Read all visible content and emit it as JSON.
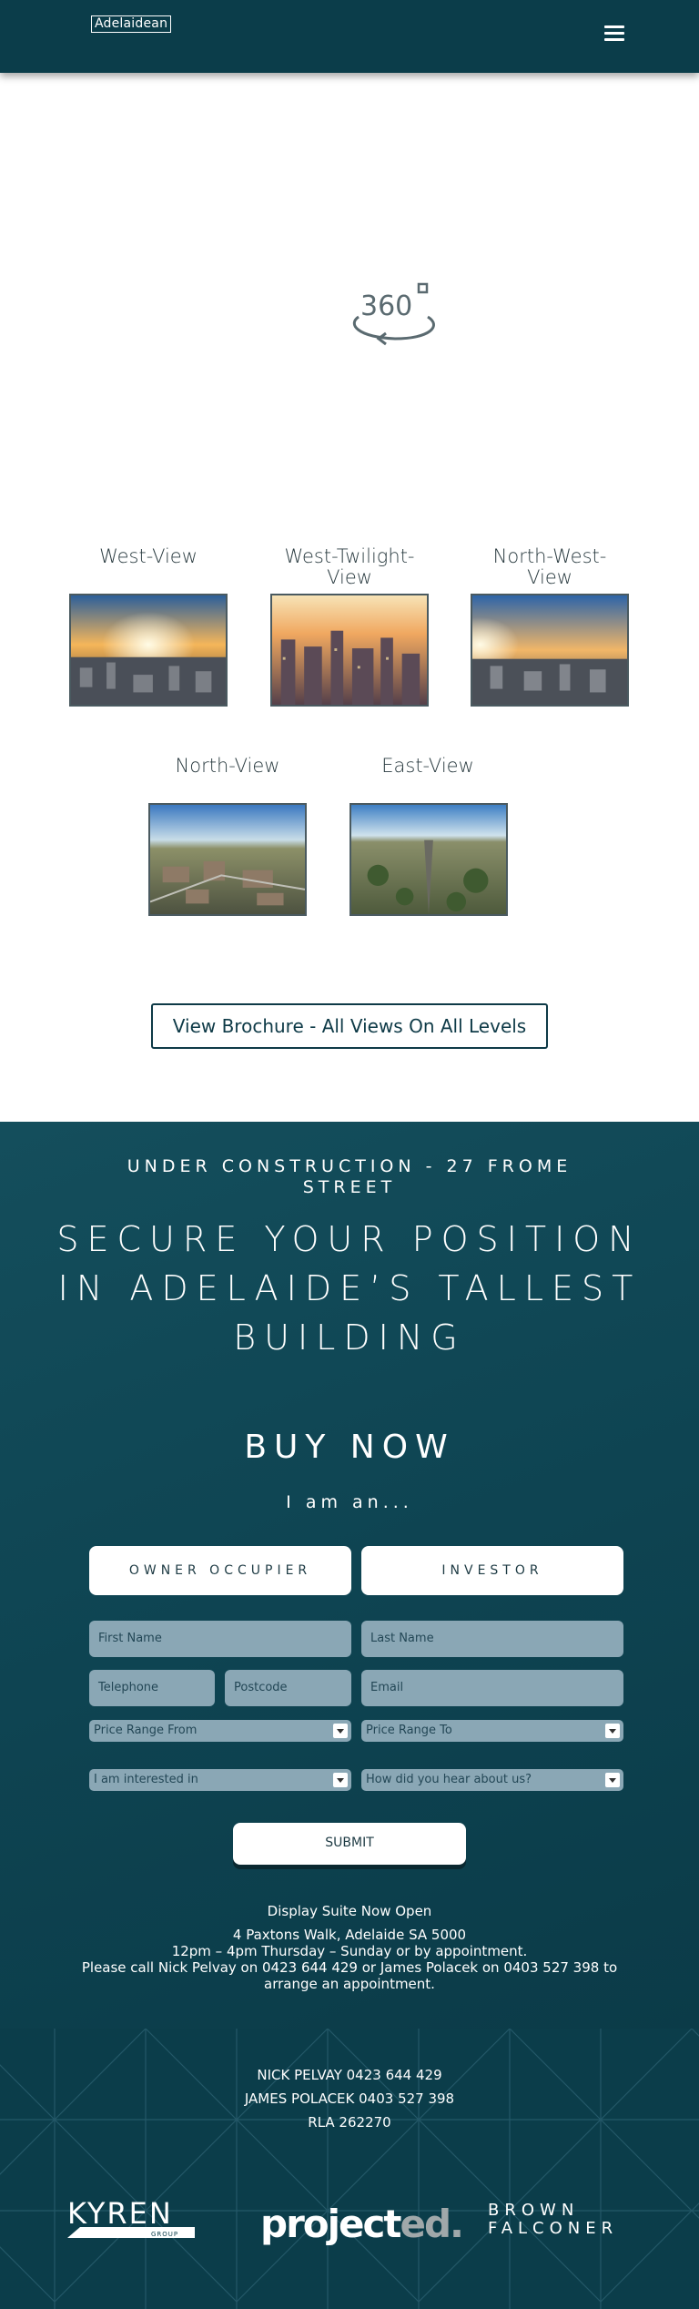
{
  "header": {
    "logo_text": "Adelaidean",
    "menu_icon": "hamburger-menu-icon"
  },
  "panorama": {
    "icon": "360-view-icon",
    "icon_text": "360"
  },
  "views": [
    {
      "title": "West-View"
    },
    {
      "title": "West-Twilight-View"
    },
    {
      "title": "North-West-View"
    },
    {
      "title": "North-View"
    },
    {
      "title": "East-View"
    }
  ],
  "brochure_button": "View Brochure - All Views On All Levels",
  "cta": {
    "under_construction": "UNDER CONSTRUCTION -  27 FROME STREET",
    "headline": "SECURE YOUR POSITION IN ADELAIDE’S TALLEST BUILDING",
    "buy_now": "BUY NOW",
    "i_am_an": "I am an...",
    "owner_occupier": "OWNER OCCUPIER",
    "investor": "INVESTOR"
  },
  "form": {
    "first_name_placeholder": "First Name",
    "last_name_placeholder": "Last Name",
    "telephone_placeholder": "Telephone",
    "postcode_placeholder": "Postcode",
    "email_placeholder": "Email",
    "price_from": "Price Range From",
    "price_to": "Price Range To",
    "interested_in": "I am interested in",
    "heard_about": "How did you hear about us?",
    "submit": "SUBMIT"
  },
  "display_suite": {
    "heading": "Display Suite Now Open",
    "address": "4 Paxtons Walk, Adelaide SA 5000",
    "hours": "12pm – 4pm Thursday – Sunday or by appointment.",
    "call": "Please call Nick Pelvay on 0423 644 429 or James Polacek on 0403 527 398 to arrange an appointment."
  },
  "footer": {
    "contact_1": "NICK PELVAY   0423 644 429",
    "contact_2": "JAMES POLACEK   0403 527 398",
    "rla": "RLA 262270",
    "logos": {
      "kyren": "KYREN",
      "kyren_sub": "GROUP",
      "projected_1": "project",
      "projected_2": "ed.",
      "brown_falconer_1": "BROWN",
      "brown_falconer_2": "FALCONER"
    }
  }
}
